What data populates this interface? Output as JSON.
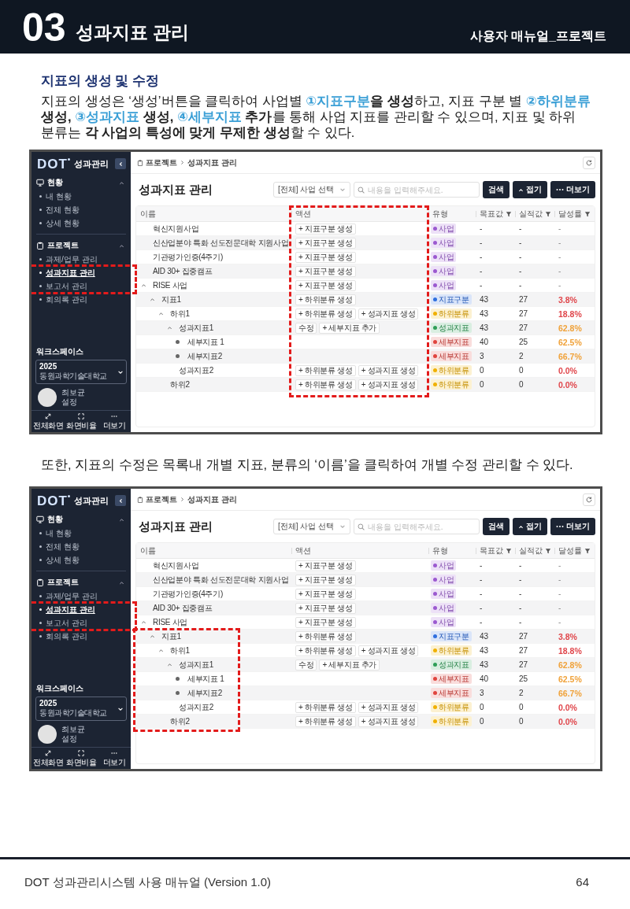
{
  "header": {
    "number": "03",
    "title": "성과지표 관리",
    "subtitle": "사용자 매뉴얼_프로젝트"
  },
  "section": {
    "title": "지표의 생성 및 수정",
    "intro": [
      {
        "text": "지표의 생성은 ‘생성’버튼을 클릭하여 사업별 ",
        "kind": "plain"
      },
      {
        "text": "①지표구분",
        "kind": "accent"
      },
      {
        "text": "을 생성",
        "kind": "bold"
      },
      {
        "text": "하고, 지표 구분 별 ",
        "kind": "plain"
      },
      {
        "text": "②하위분류",
        "kind": "accent"
      },
      {
        "text": " 생성, ",
        "kind": "bold"
      },
      {
        "text": "③성과지표",
        "kind": "accent"
      },
      {
        "text": " 생성, ",
        "kind": "bold"
      },
      {
        "text": "④세부지표",
        "kind": "accent"
      },
      {
        "text": " 추가",
        "kind": "bold"
      },
      {
        "text": "를 통해 사업 지표를 관리할 수 있으며, 지표 및 하위 분류는 ",
        "kind": "plain"
      },
      {
        "text": "각 사업의 특성에 맞게 무제한 생성",
        "kind": "bold"
      },
      {
        "text": "할 수 있다.",
        "kind": "plain"
      }
    ]
  },
  "blocks": [
    {
      "kind": "screenshot",
      "sidebar": {
        "logo": "DOT",
        "app_name": "성과관리",
        "sections": [
          {
            "label": "현황",
            "expanded": true,
            "items": [
              {
                "label": "내 현황",
                "selected": false
              },
              {
                "label": "전체 현황",
                "selected": false
              },
              {
                "label": "상세 현황",
                "selected": false
              }
            ]
          },
          {
            "label": "프로젝트",
            "expanded": true,
            "items": [
              {
                "label": "과제/업무 관리",
                "selected": false
              },
              {
                "label": "성과지표 관리",
                "selected": true
              },
              {
                "label": "보고서 관리",
                "selected": false
              },
              {
                "label": "회의록 관리",
                "selected": false
              }
            ]
          }
        ],
        "workspace": {
          "label": "워크스페이스",
          "year": "2025",
          "org": "동원과학기술대학교"
        },
        "user": {
          "name": "최보균",
          "link": "설정"
        },
        "tools": [
          "전체화면",
          "화면비율",
          "더보기"
        ]
      },
      "breadcrumb": [
        "프로젝트",
        "성과지표 관리"
      ],
      "title": "성과지표 관리",
      "business_select": "[전체] 사업 선택",
      "search": {
        "placeholder": "내용을 입력해주세요."
      },
      "buttons": [
        "검색",
        "접기",
        "더보기"
      ],
      "table": {
        "columns": [
          {
            "label": "이름"
          },
          {
            "label": "액션"
          },
          {
            "label": "유형"
          },
          {
            "label": "목표값",
            "filter": true
          },
          {
            "label": "실적값",
            "filter": true
          },
          {
            "label": "달성률",
            "filter": true
          }
        ],
        "rows": [
          {
            "name": "혁신지원사업",
            "actions": [
              "+ 지표구분 생성"
            ],
            "type": {
              "label": "사업",
              "color": "#9b59d0"
            },
            "target": "-",
            "actual": "-",
            "rate": {
              "text": "-"
            }
          },
          {
            "name": "신산업분야 특화 선도전문대학 지원사업",
            "actions": [
              "+ 지표구분 생성"
            ],
            "type": {
              "label": "사업",
              "color": "#9b59d0"
            },
            "target": "-",
            "actual": "-",
            "rate": {
              "text": "-"
            }
          },
          {
            "name": "기관평가인증(4주기)",
            "actions": [
              "+ 지표구분 생성"
            ],
            "type": {
              "label": "사업",
              "color": "#9b59d0"
            },
            "target": "-",
            "actual": "-",
            "rate": {
              "text": "-"
            }
          },
          {
            "name": "AID 30+ 집중캠프",
            "actions": [
              "+ 지표구분 생성"
            ],
            "type": {
              "label": "사업",
              "color": "#9b59d0"
            },
            "target": "-",
            "actual": "-",
            "rate": {
              "text": "-"
            }
          },
          {
            "name": "RISE 사업",
            "expanded": true,
            "actions": [
              "+ 지표구분 생성"
            ],
            "type": {
              "label": "사업",
              "color": "#9b59d0"
            },
            "target": "-",
            "actual": "-",
            "rate": {
              "text": "-"
            },
            "children": [
              {
                "name": "지표1",
                "expanded": true,
                "actions": [
                  "+ 하위분류 생성"
                ],
                "type": {
                  "label": "지표구분",
                  "color": "#2f6fdf"
                },
                "target": "43",
                "actual": "27",
                "rate": {
                  "text": "3.8%",
                  "color": "#e0474c"
                },
                "children": [
                  {
                    "name": "하위1",
                    "expanded": true,
                    "actions": [
                      "+ 하위분류 생성",
                      "+ 성과지표 생성"
                    ],
                    "type": {
                      "label": "하위분류",
                      "color": "#f0b000"
                    },
                    "target": "43",
                    "actual": "27",
                    "rate": {
                      "text": "18.8%",
                      "color": "#e0474c"
                    },
                    "children": [
                      {
                        "name": "성과지표1",
                        "expanded": true,
                        "actions": [
                          "수정",
                          "+ 세부지표 추가"
                        ],
                        "type": {
                          "label": "성과지표",
                          "color": "#2e9e57"
                        },
                        "target": "43",
                        "actual": "27",
                        "rate": {
                          "text": "62.8%",
                          "color": "#f0a23a"
                        },
                        "children": [
                          {
                            "name": "세부지표 1",
                            "bullet": true,
                            "type": {
                              "label": "세부지표",
                              "color": "#e0443e"
                            },
                            "target": "40",
                            "actual": "25",
                            "rate": {
                              "text": "62.5%",
                              "color": "#f0a23a"
                            }
                          },
                          {
                            "name": "세부지표2",
                            "bullet": true,
                            "type": {
                              "label": "세부지표",
                              "color": "#e0443e"
                            },
                            "target": "3",
                            "actual": "2",
                            "rate": {
                              "text": "66.7%",
                              "color": "#f0a23a"
                            }
                          }
                        ]
                      },
                      {
                        "name": "성과지표2",
                        "actions": [
                          "+ 하위분류 생성",
                          "+ 성과지표 생성"
                        ],
                        "type": {
                          "label": "하위분류",
                          "color": "#f0b000"
                        },
                        "target": "0",
                        "actual": "0",
                        "rate": {
                          "text": "0.0%",
                          "color": "#e0474c"
                        }
                      }
                    ]
                  },
                  {
                    "name": "하위2",
                    "actions": [
                      "+ 하위분류 생성",
                      "+ 성과지표 생성"
                    ],
                    "type": {
                      "label": "하위분류",
                      "color": "#f0b000"
                    },
                    "target": "0",
                    "actual": "0",
                    "rate": {
                      "text": "0.0%",
                      "color": "#e0474c"
                    }
                  }
                ]
              }
            ]
          }
        ]
      },
      "highlights": [
        {
          "kind": "sidebar"
        },
        {
          "kind": "actions"
        }
      ]
    },
    {
      "kind": "note",
      "text": "또한, 지표의 수정은 목록내 개별 지표, 분류의 ‘이름’을 클릭하여 개별 수정 관리할 수 있다."
    },
    {
      "kind": "screenshot",
      "sidebar": {
        "logo": "DOT",
        "app_name": "성과관리",
        "sections": [
          {
            "label": "현황",
            "expanded": true,
            "items": [
              {
                "label": "내 현황",
                "selected": false
              },
              {
                "label": "전체 현황",
                "selected": false
              },
              {
                "label": "상세 현황",
                "selected": false
              }
            ]
          },
          {
            "label": "프로젝트",
            "expanded": true,
            "items": [
              {
                "label": "과제/업무 관리",
                "selected": false
              },
              {
                "label": "성과지표 관리",
                "selected": true
              },
              {
                "label": "보고서 관리",
                "selected": false
              },
              {
                "label": "회의록 관리",
                "selected": false
              }
            ]
          }
        ],
        "workspace": {
          "label": "워크스페이스",
          "year": "2025",
          "org": "동원과학기술대학교"
        },
        "user": {
          "name": "최보균",
          "link": "설정"
        },
        "tools": [
          "전체화면",
          "화면비율",
          "더보기"
        ]
      },
      "breadcrumb": [
        "프로젝트",
        "성과지표 관리"
      ],
      "title": "성과지표 관리",
      "business_select": "[전체] 사업 선택",
      "search": {
        "placeholder": "내용을 입력해주세요."
      },
      "buttons": [
        "검색",
        "접기",
        "더보기"
      ],
      "table": {
        "columns": [
          {
            "label": "이름"
          },
          {
            "label": "액션"
          },
          {
            "label": "유형"
          },
          {
            "label": "목표값",
            "filter": true
          },
          {
            "label": "실적값",
            "filter": true
          },
          {
            "label": "달성률",
            "filter": true
          }
        ],
        "rows": [
          {
            "name": "혁신지원사업",
            "actions": [
              "+ 지표구분 생성"
            ],
            "type": {
              "label": "사업",
              "color": "#9b59d0"
            },
            "target": "-",
            "actual": "-",
            "rate": {
              "text": "-"
            }
          },
          {
            "name": "신산업분야 특화 선도전문대학 지원사업",
            "actions": [
              "+ 지표구분 생성"
            ],
            "type": {
              "label": "사업",
              "color": "#9b59d0"
            },
            "target": "-",
            "actual": "-",
            "rate": {
              "text": "-"
            }
          },
          {
            "name": "기관평가인증(4주기)",
            "actions": [
              "+ 지표구분 생성"
            ],
            "type": {
              "label": "사업",
              "color": "#9b59d0"
            },
            "target": "-",
            "actual": "-",
            "rate": {
              "text": "-"
            }
          },
          {
            "name": "AID 30+ 집중캠프",
            "actions": [
              "+ 지표구분 생성"
            ],
            "type": {
              "label": "사업",
              "color": "#9b59d0"
            },
            "target": "-",
            "actual": "-",
            "rate": {
              "text": "-"
            }
          },
          {
            "name": "RISE 사업",
            "expanded": true,
            "actions": [
              "+ 지표구분 생성"
            ],
            "type": {
              "label": "사업",
              "color": "#9b59d0"
            },
            "target": "-",
            "actual": "-",
            "rate": {
              "text": "-"
            },
            "children": [
              {
                "name": "지표1",
                "expanded": true,
                "actions": [
                  "+ 하위분류 생성"
                ],
                "type": {
                  "label": "지표구분",
                  "color": "#2f6fdf"
                },
                "target": "43",
                "actual": "27",
                "rate": {
                  "text": "3.8%",
                  "color": "#e0474c"
                },
                "children": [
                  {
                    "name": "하위1",
                    "expanded": true,
                    "actions": [
                      "+ 하위분류 생성",
                      "+ 성과지표 생성"
                    ],
                    "type": {
                      "label": "하위분류",
                      "color": "#f0b000"
                    },
                    "target": "43",
                    "actual": "27",
                    "rate": {
                      "text": "18.8%",
                      "color": "#e0474c"
                    },
                    "children": [
                      {
                        "name": "성과지표1",
                        "expanded": true,
                        "actions": [
                          "수정",
                          "+ 세부지표 추가"
                        ],
                        "type": {
                          "label": "성과지표",
                          "color": "#2e9e57"
                        },
                        "target": "43",
                        "actual": "27",
                        "rate": {
                          "text": "62.8%",
                          "color": "#f0a23a"
                        },
                        "children": [
                          {
                            "name": "세부지표 1",
                            "bullet": true,
                            "type": {
                              "label": "세부지표",
                              "color": "#e0443e"
                            },
                            "target": "40",
                            "actual": "25",
                            "rate": {
                              "text": "62.5%",
                              "color": "#f0a23a"
                            }
                          },
                          {
                            "name": "세부지표2",
                            "bullet": true,
                            "type": {
                              "label": "세부지표",
                              "color": "#e0443e"
                            },
                            "target": "3",
                            "actual": "2",
                            "rate": {
                              "text": "66.7%",
                              "color": "#f0a23a"
                            }
                          }
                        ]
                      },
                      {
                        "name": "성과지표2",
                        "actions": [
                          "+ 하위분류 생성",
                          "+ 성과지표 생성"
                        ],
                        "type": {
                          "label": "하위분류",
                          "color": "#f0b000"
                        },
                        "target": "0",
                        "actual": "0",
                        "rate": {
                          "text": "0.0%",
                          "color": "#e0474c"
                        }
                      }
                    ]
                  },
                  {
                    "name": "하위2",
                    "actions": [
                      "+ 하위분류 생성",
                      "+ 성과지표 생성"
                    ],
                    "type": {
                      "label": "하위분류",
                      "color": "#f0b000"
                    },
                    "target": "0",
                    "actual": "0",
                    "rate": {
                      "text": "0.0%",
                      "color": "#e0474c"
                    }
                  }
                ]
              }
            ]
          }
        ]
      },
      "highlights": [
        {
          "kind": "sidebar"
        },
        {
          "kind": "branch"
        }
      ]
    }
  ],
  "footer": {
    "title": "DOT 성과관리시스템 사용 매뉴얼 (Version 1.0)",
    "page": "64"
  }
}
